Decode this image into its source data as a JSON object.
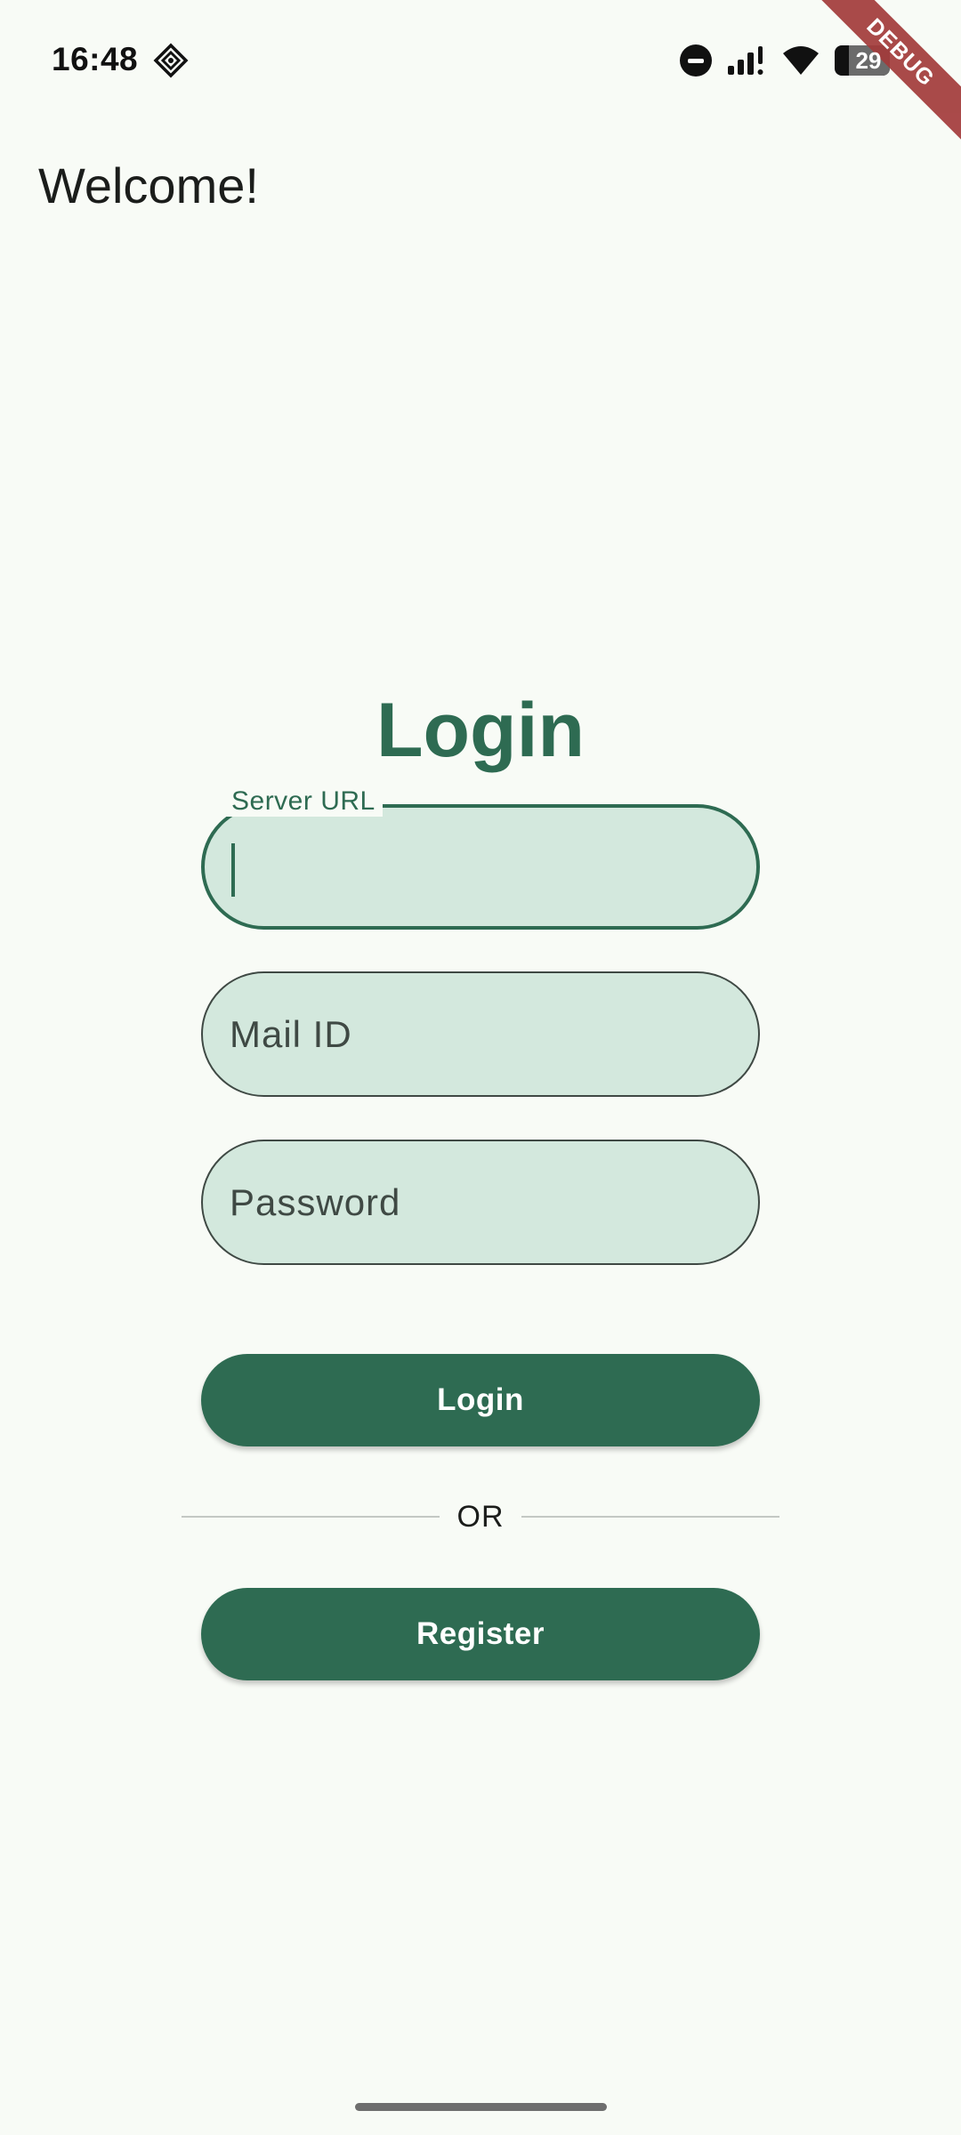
{
  "status_bar": {
    "time": "16:48",
    "battery_level": "29",
    "icons": [
      "location-diamond-icon",
      "do-not-disturb-icon",
      "signal-icon",
      "wifi-icon",
      "battery-icon"
    ]
  },
  "debug_banner": "DEBUG",
  "app_bar": {
    "title": "Welcome!"
  },
  "login_form": {
    "heading": "Login",
    "server_url": {
      "label": "Server URL",
      "value": ""
    },
    "mail_id": {
      "placeholder": "Mail ID",
      "value": ""
    },
    "password": {
      "placeholder": "Password",
      "value": ""
    },
    "login_button": "Login",
    "divider_text": "OR",
    "register_button": "Register"
  },
  "colors": {
    "primary": "#2e6b52",
    "field_fill": "#d3e8dd",
    "background": "#f8fbf6",
    "debug_ribbon": "#a33b3b"
  }
}
